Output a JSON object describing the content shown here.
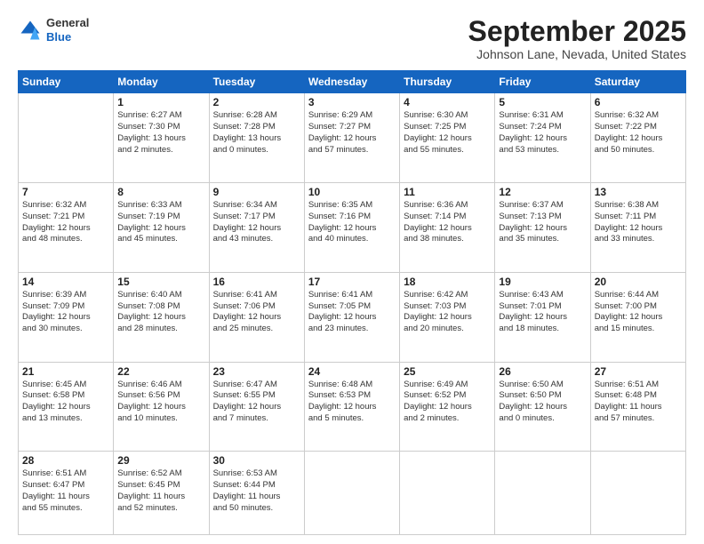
{
  "header": {
    "logo": {
      "general": "General",
      "blue": "Blue"
    },
    "title": "September 2025",
    "location": "Johnson Lane, Nevada, United States"
  },
  "days_of_week": [
    "Sunday",
    "Monday",
    "Tuesday",
    "Wednesday",
    "Thursday",
    "Friday",
    "Saturday"
  ],
  "weeks": [
    [
      {
        "day": "",
        "info": ""
      },
      {
        "day": "1",
        "info": "Sunrise: 6:27 AM\nSunset: 7:30 PM\nDaylight: 13 hours\nand 2 minutes."
      },
      {
        "day": "2",
        "info": "Sunrise: 6:28 AM\nSunset: 7:28 PM\nDaylight: 13 hours\nand 0 minutes."
      },
      {
        "day": "3",
        "info": "Sunrise: 6:29 AM\nSunset: 7:27 PM\nDaylight: 12 hours\nand 57 minutes."
      },
      {
        "day": "4",
        "info": "Sunrise: 6:30 AM\nSunset: 7:25 PM\nDaylight: 12 hours\nand 55 minutes."
      },
      {
        "day": "5",
        "info": "Sunrise: 6:31 AM\nSunset: 7:24 PM\nDaylight: 12 hours\nand 53 minutes."
      },
      {
        "day": "6",
        "info": "Sunrise: 6:32 AM\nSunset: 7:22 PM\nDaylight: 12 hours\nand 50 minutes."
      }
    ],
    [
      {
        "day": "7",
        "info": "Sunrise: 6:32 AM\nSunset: 7:21 PM\nDaylight: 12 hours\nand 48 minutes."
      },
      {
        "day": "8",
        "info": "Sunrise: 6:33 AM\nSunset: 7:19 PM\nDaylight: 12 hours\nand 45 minutes."
      },
      {
        "day": "9",
        "info": "Sunrise: 6:34 AM\nSunset: 7:17 PM\nDaylight: 12 hours\nand 43 minutes."
      },
      {
        "day": "10",
        "info": "Sunrise: 6:35 AM\nSunset: 7:16 PM\nDaylight: 12 hours\nand 40 minutes."
      },
      {
        "day": "11",
        "info": "Sunrise: 6:36 AM\nSunset: 7:14 PM\nDaylight: 12 hours\nand 38 minutes."
      },
      {
        "day": "12",
        "info": "Sunrise: 6:37 AM\nSunset: 7:13 PM\nDaylight: 12 hours\nand 35 minutes."
      },
      {
        "day": "13",
        "info": "Sunrise: 6:38 AM\nSunset: 7:11 PM\nDaylight: 12 hours\nand 33 minutes."
      }
    ],
    [
      {
        "day": "14",
        "info": "Sunrise: 6:39 AM\nSunset: 7:09 PM\nDaylight: 12 hours\nand 30 minutes."
      },
      {
        "day": "15",
        "info": "Sunrise: 6:40 AM\nSunset: 7:08 PM\nDaylight: 12 hours\nand 28 minutes."
      },
      {
        "day": "16",
        "info": "Sunrise: 6:41 AM\nSunset: 7:06 PM\nDaylight: 12 hours\nand 25 minutes."
      },
      {
        "day": "17",
        "info": "Sunrise: 6:41 AM\nSunset: 7:05 PM\nDaylight: 12 hours\nand 23 minutes."
      },
      {
        "day": "18",
        "info": "Sunrise: 6:42 AM\nSunset: 7:03 PM\nDaylight: 12 hours\nand 20 minutes."
      },
      {
        "day": "19",
        "info": "Sunrise: 6:43 AM\nSunset: 7:01 PM\nDaylight: 12 hours\nand 18 minutes."
      },
      {
        "day": "20",
        "info": "Sunrise: 6:44 AM\nSunset: 7:00 PM\nDaylight: 12 hours\nand 15 minutes."
      }
    ],
    [
      {
        "day": "21",
        "info": "Sunrise: 6:45 AM\nSunset: 6:58 PM\nDaylight: 12 hours\nand 13 minutes."
      },
      {
        "day": "22",
        "info": "Sunrise: 6:46 AM\nSunset: 6:56 PM\nDaylight: 12 hours\nand 10 minutes."
      },
      {
        "day": "23",
        "info": "Sunrise: 6:47 AM\nSunset: 6:55 PM\nDaylight: 12 hours\nand 7 minutes."
      },
      {
        "day": "24",
        "info": "Sunrise: 6:48 AM\nSunset: 6:53 PM\nDaylight: 12 hours\nand 5 minutes."
      },
      {
        "day": "25",
        "info": "Sunrise: 6:49 AM\nSunset: 6:52 PM\nDaylight: 12 hours\nand 2 minutes."
      },
      {
        "day": "26",
        "info": "Sunrise: 6:50 AM\nSunset: 6:50 PM\nDaylight: 12 hours\nand 0 minutes."
      },
      {
        "day": "27",
        "info": "Sunrise: 6:51 AM\nSunset: 6:48 PM\nDaylight: 11 hours\nand 57 minutes."
      }
    ],
    [
      {
        "day": "28",
        "info": "Sunrise: 6:51 AM\nSunset: 6:47 PM\nDaylight: 11 hours\nand 55 minutes."
      },
      {
        "day": "29",
        "info": "Sunrise: 6:52 AM\nSunset: 6:45 PM\nDaylight: 11 hours\nand 52 minutes."
      },
      {
        "day": "30",
        "info": "Sunrise: 6:53 AM\nSunset: 6:44 PM\nDaylight: 11 hours\nand 50 minutes."
      },
      {
        "day": "",
        "info": ""
      },
      {
        "day": "",
        "info": ""
      },
      {
        "day": "",
        "info": ""
      },
      {
        "day": "",
        "info": ""
      }
    ]
  ]
}
